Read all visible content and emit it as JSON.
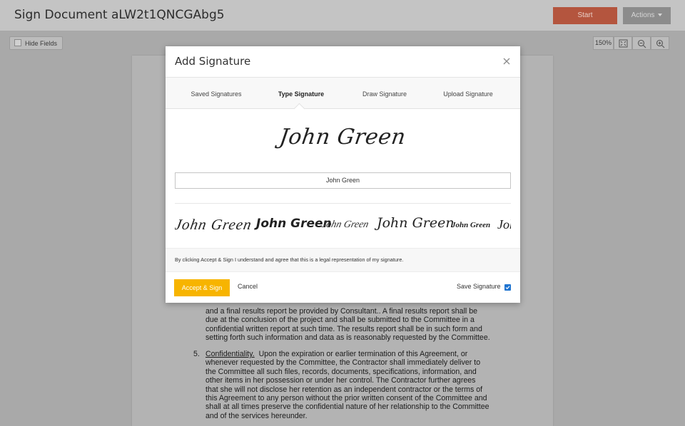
{
  "header": {
    "title": "Sign Document aLW2t1QNCGAbg5",
    "start_label": "Start",
    "actions_label": "Actions"
  },
  "toolbar": {
    "hide_fields_label": "Hide Fields",
    "zoom_level": "150%",
    "icons": [
      "fit-page-icon",
      "zoom-out-icon",
      "zoom-in-icon"
    ]
  },
  "document": {
    "item4_lines": [
      "and a final results report be provided by Consultant..  A final results report shall be",
      "due at the conclusion of the project and shall be submitted to the Committee in a",
      "confidential written report at such time. The results report shall be in such form and",
      "setting forth such information and data as is reasonably requested by the Committee."
    ],
    "item5_number": "5.",
    "item5_heading": "Confidentiality.",
    "item5_first_line": "Upon the expiration or earlier termination of this Agreement, or",
    "item5_lines": [
      "whenever requested by the Committee, the Contractor shall immediately deliver to",
      "the Committee all such files, records, documents, specifications, information, and",
      "other items in her possession or under her control.  The Contractor further agrees",
      "that she will not disclose her retention as an independent contractor or the terms of",
      "this Agreement to any person without the prior written consent of the Committee and",
      "shall at all times preserve the confidential nature of her relationship to the Committee",
      "and of the services hereunder."
    ]
  },
  "modal": {
    "title": "Add Signature",
    "close_icon": "close-icon",
    "tabs": [
      {
        "label": "Saved Signatures",
        "active": false
      },
      {
        "label": "Type Signature",
        "active": true
      },
      {
        "label": "Draw Signature",
        "active": false
      },
      {
        "label": "Upload Signature",
        "active": false
      }
    ],
    "preview_name": "John Green",
    "name_input_value": "John Green",
    "signature_styles": [
      "John Green",
      "John Green",
      "John Green",
      "John Green",
      "John Green",
      "John"
    ],
    "legal_text": "By clicking Accept & Sign I understand and agree that this is a legal representation of my signature.",
    "accept_label": "Accept & Sign",
    "cancel_label": "Cancel",
    "save_signature_label": "Save Signature",
    "save_signature_checked": true
  },
  "colors": {
    "start_button": "#b4553e",
    "accept_button": "#f7b400",
    "checkbox": "#1f74d0"
  }
}
